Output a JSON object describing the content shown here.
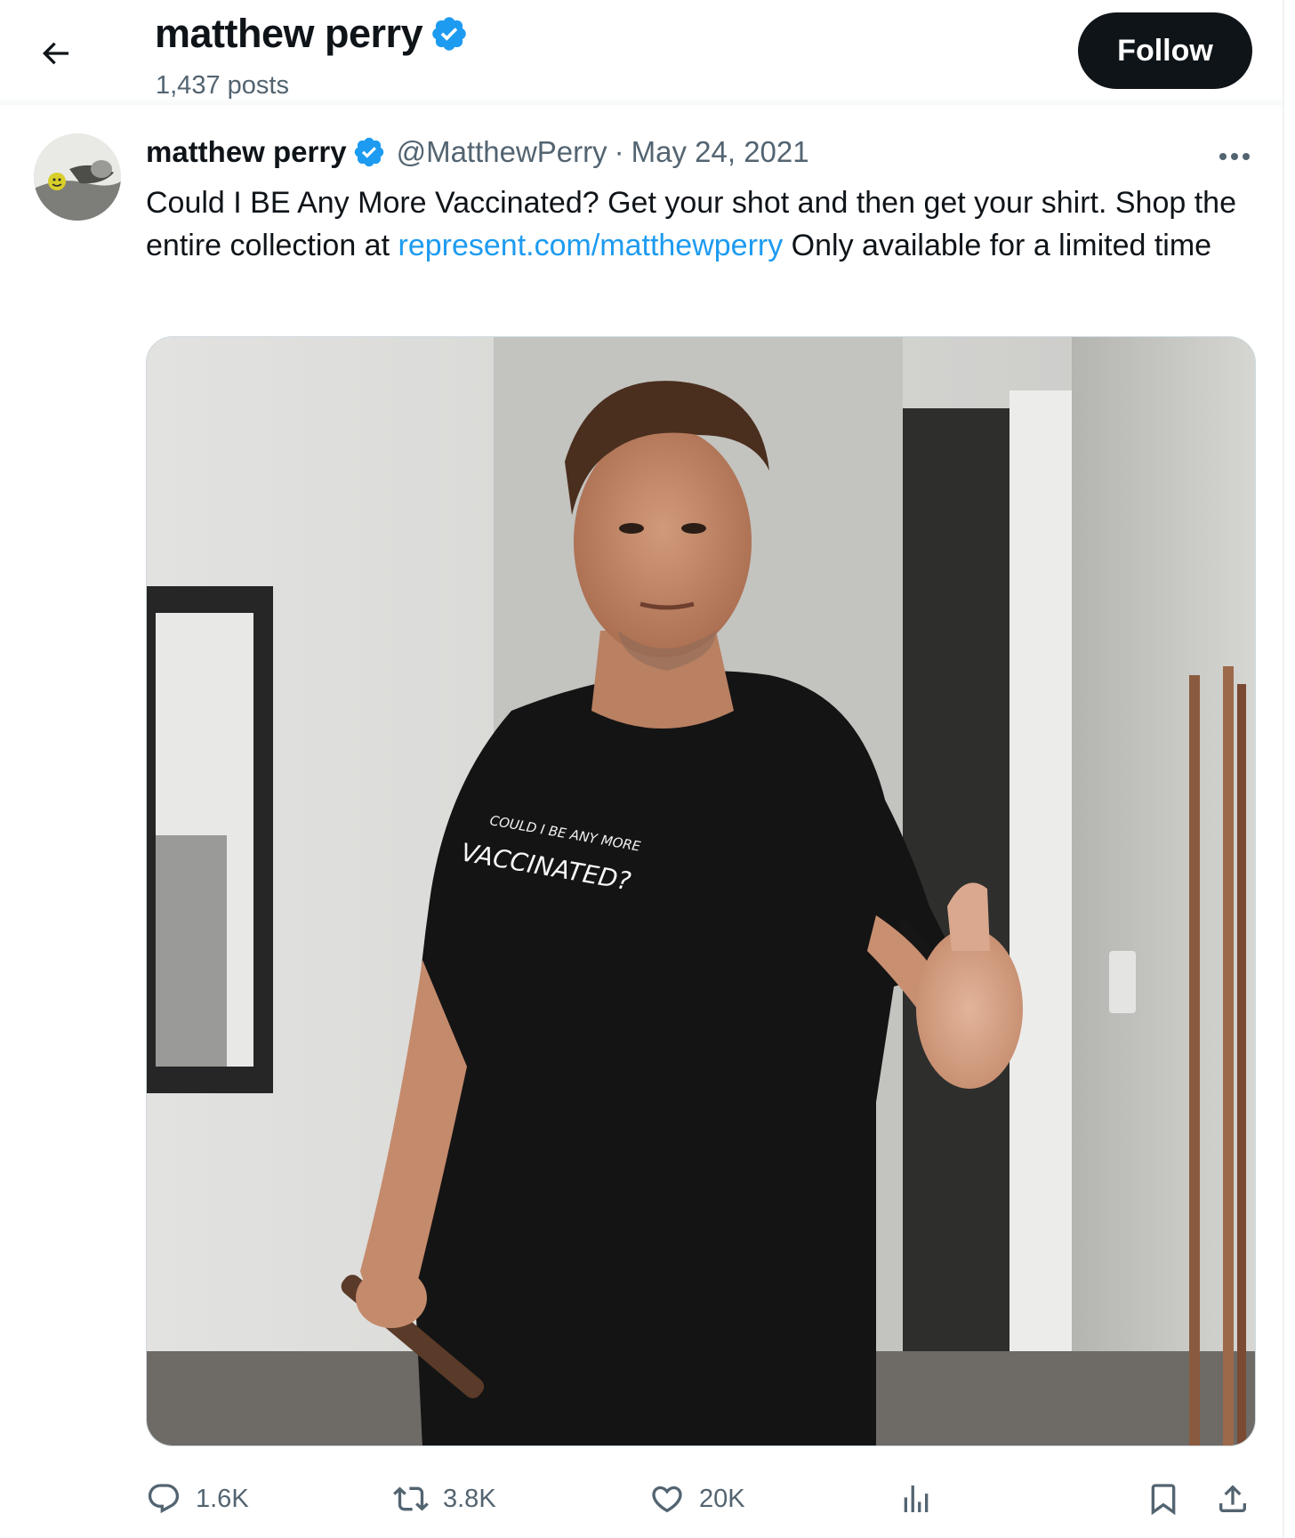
{
  "header": {
    "back_icon": "arrow-left-icon",
    "title": "matthew perry",
    "posts_count": "1,437 posts",
    "follow_label": "Follow"
  },
  "tweet": {
    "author_name": "matthew perry",
    "handle": "@MatthewPerry",
    "separator": "·",
    "date": "May 24, 2021",
    "text_before_link": "Could I BE Any More Vaccinated? Get your shot and then get your shirt. Shop the entire collection at ",
    "link_text": "represent.com/matthewperry",
    "text_after_link": " Only available for a limited time",
    "photo": {
      "shirt_line1": "COULD I BE ANY MORE",
      "shirt_line2": "VACCINATED?"
    }
  },
  "actions": {
    "replies": "1.6K",
    "reposts": "3.8K",
    "likes": "20K"
  },
  "icons": {
    "verified": "verified-badge-icon",
    "more": "more-icon",
    "reply": "reply-icon",
    "repost": "repost-icon",
    "like": "heart-icon",
    "views": "views-chart-icon",
    "bookmark": "bookmark-icon",
    "share": "share-icon"
  },
  "colors": {
    "accent": "#1d9bf0",
    "text_primary": "#0f1419",
    "text_secondary": "#536471",
    "follow_bg": "#0f1419"
  }
}
